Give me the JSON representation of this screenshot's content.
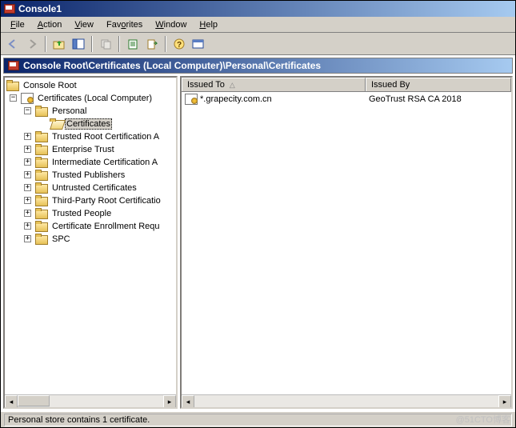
{
  "window": {
    "title": "Console1"
  },
  "menu": {
    "file": "File",
    "action": "Action",
    "view": "View",
    "favorites": "Favorites",
    "window": "Window",
    "help": "Help"
  },
  "path": {
    "text": "Console Root\\Certificates (Local Computer)\\Personal\\Certificates"
  },
  "tree": {
    "root": "Console Root",
    "certs": "Certificates (Local Computer)",
    "personal": "Personal",
    "certificates": "Certificates",
    "items": [
      "Trusted Root Certification A",
      "Enterprise Trust",
      "Intermediate Certification A",
      "Trusted Publishers",
      "Untrusted Certificates",
      "Third-Party Root Certificatio",
      "Trusted People",
      "Certificate Enrollment Requ",
      "SPC"
    ]
  },
  "list": {
    "columns": {
      "issued_to": "Issued To",
      "issued_by": "Issued By"
    },
    "rows": [
      {
        "issued_to": "*.grapecity.com.cn",
        "issued_by": "GeoTrust RSA CA 2018"
      }
    ]
  },
  "status": {
    "text": "Personal store contains 1 certificate."
  },
  "watermark": "@51CTO博客"
}
